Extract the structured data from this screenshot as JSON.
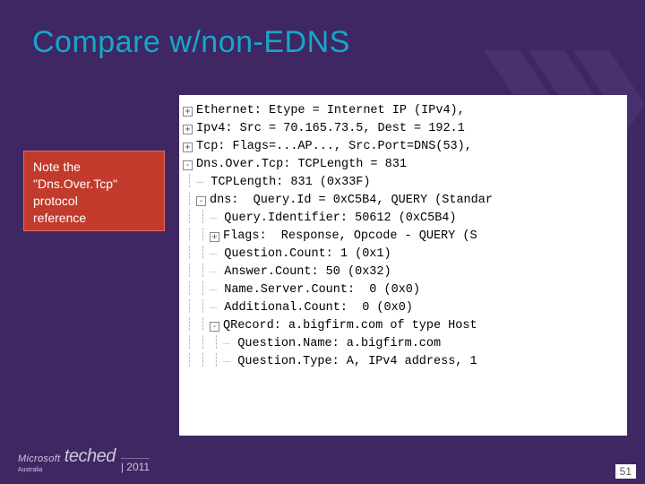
{
  "title": "Compare w/non-EDNS",
  "callout": {
    "line1": "Note the",
    "line2": "\"Dns.Over.Tcp\"",
    "line3": "protocol",
    "line4": "reference"
  },
  "rows": [
    {
      "depth": 0,
      "toggle": "+",
      "text": "Ethernet: Etype = Internet IP (IPv4),"
    },
    {
      "depth": 0,
      "toggle": "+",
      "text": "Ipv4: Src = 70.165.73.5, Dest = 192.1"
    },
    {
      "depth": 0,
      "toggle": "+",
      "text": "Tcp: Flags=...AP..., Src.Port=DNS(53),"
    },
    {
      "depth": 0,
      "toggle": "-",
      "text": "Dns.Over.Tcp: TCPLength = 831"
    },
    {
      "depth": 1,
      "toggle": "",
      "text": "TCPLength: 831 (0x33F)"
    },
    {
      "depth": 1,
      "toggle": "-",
      "text": "dns:  Query.Id = 0xC5B4, QUERY (Standar"
    },
    {
      "depth": 2,
      "toggle": "",
      "text": "Query.Identifier: 50612 (0xC5B4)"
    },
    {
      "depth": 2,
      "toggle": "+",
      "text": "Flags:  Response, Opcode - QUERY (S"
    },
    {
      "depth": 2,
      "toggle": "",
      "text": "Question.Count: 1 (0x1)"
    },
    {
      "depth": 2,
      "toggle": "",
      "text": "Answer.Count: 50 (0x32)"
    },
    {
      "depth": 2,
      "toggle": "",
      "text": "Name.Server.Count:  0 (0x0)"
    },
    {
      "depth": 2,
      "toggle": "",
      "text": "Additional.Count:  0 (0x0)"
    },
    {
      "depth": 2,
      "toggle": "-",
      "text": "QRecord: a.bigfirm.com of type Host"
    },
    {
      "depth": 3,
      "toggle": "",
      "text": "Question.Name: a.bigfirm.com"
    },
    {
      "depth": 3,
      "toggle": "",
      "text": "Question.Type: A, IPv4 address, 1"
    }
  ],
  "footer": {
    "ms": "Microsoft",
    "brand": "teched",
    "australia": "Australia",
    "year": "2011"
  },
  "page": "51"
}
